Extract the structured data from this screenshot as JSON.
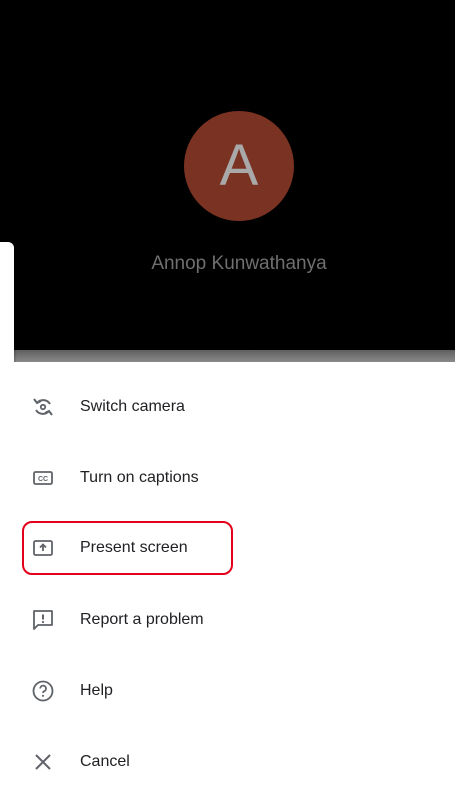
{
  "participant": {
    "avatar_letter": "A",
    "name": "Annop Kunwathanya"
  },
  "menu": {
    "items": [
      {
        "label": "Switch camera",
        "icon": "switch-camera-icon"
      },
      {
        "label": "Turn on captions",
        "icon": "captions-icon"
      },
      {
        "label": "Present screen",
        "icon": "present-screen-icon"
      },
      {
        "label": "Report a problem",
        "icon": "report-problem-icon"
      },
      {
        "label": "Help",
        "icon": "help-icon"
      },
      {
        "label": "Cancel",
        "icon": "close-icon"
      }
    ]
  },
  "colors": {
    "avatar_bg": "#7a3222",
    "highlight": "#e3001b",
    "icon": "#5f6368"
  }
}
